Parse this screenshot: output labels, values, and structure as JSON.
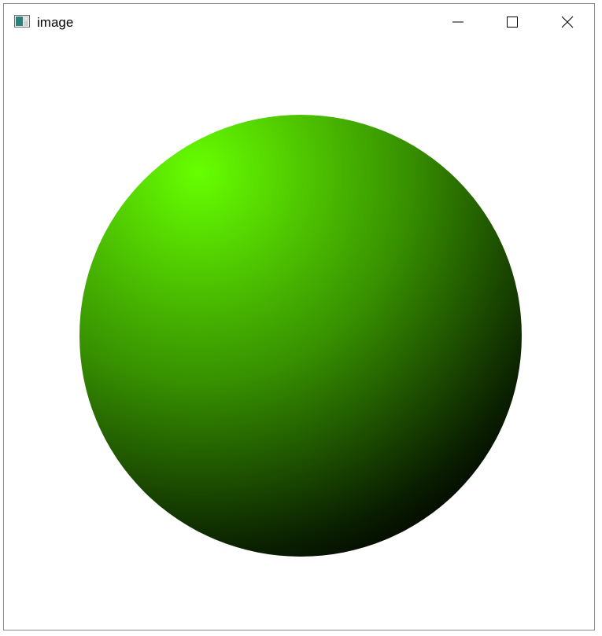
{
  "window": {
    "title": "image",
    "icon": "image-window-icon",
    "controls": {
      "minimize": "minimize-icon",
      "maximize": "maximize-icon",
      "close": "close-icon"
    }
  },
  "content": {
    "sphere": {
      "highlight_color": "#66ff00",
      "shadow_color": "#000000",
      "background_color": "#ffffff"
    }
  }
}
